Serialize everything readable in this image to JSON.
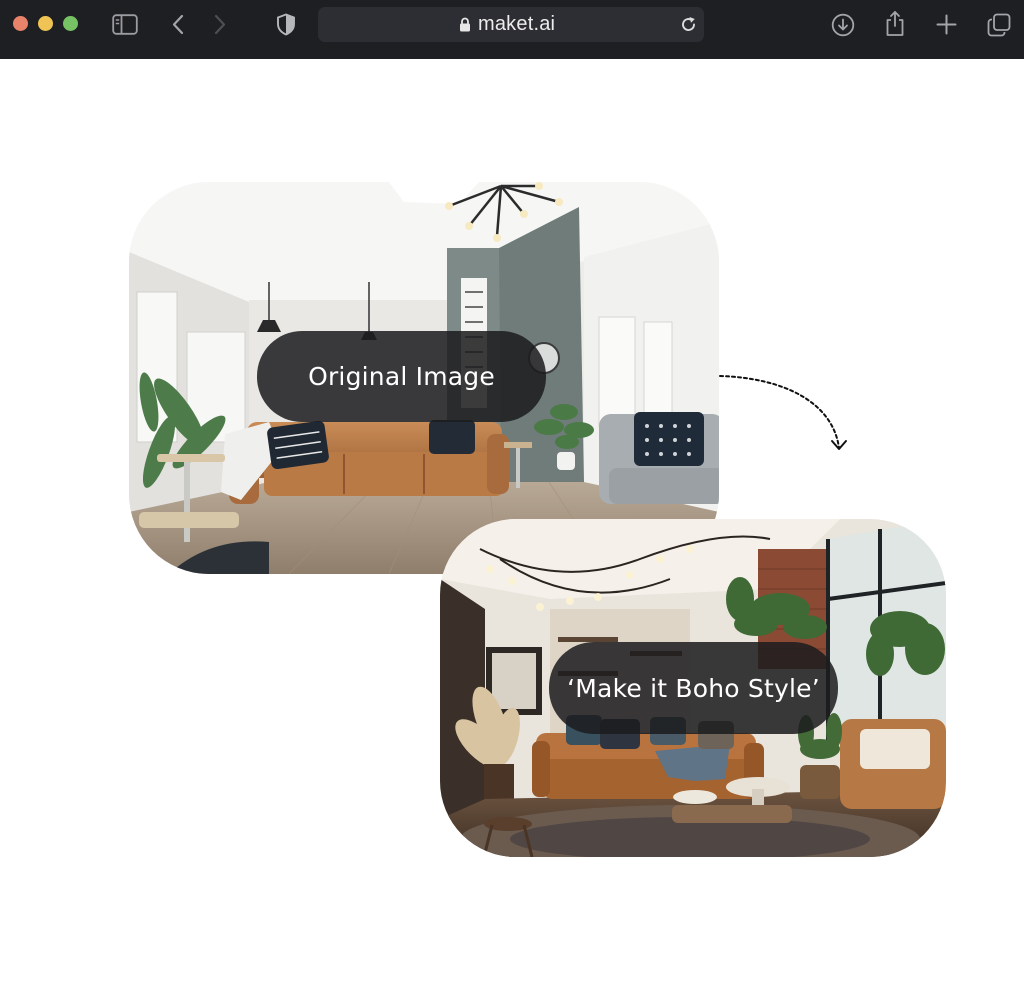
{
  "browser": {
    "url": "maket.ai",
    "icons": {
      "sidebar": "sidebar-icon",
      "back": "chevron-left-icon",
      "forward": "chevron-right-icon",
      "shield": "shield-icon",
      "lock": "lock-icon",
      "reload": "reload-icon",
      "download": "download-icon",
      "share": "share-icon",
      "new_tab": "plus-icon",
      "tabs": "tab-overview-icon"
    },
    "traffic_light_colors": [
      "#e9826a",
      "#f0c454",
      "#76c264"
    ]
  },
  "main": {
    "original_label": "Original Image",
    "result_label": "‘Make it Boho Style’"
  },
  "colors": {
    "label_background": "#1c1c1e",
    "label_text": "#ffffff"
  }
}
